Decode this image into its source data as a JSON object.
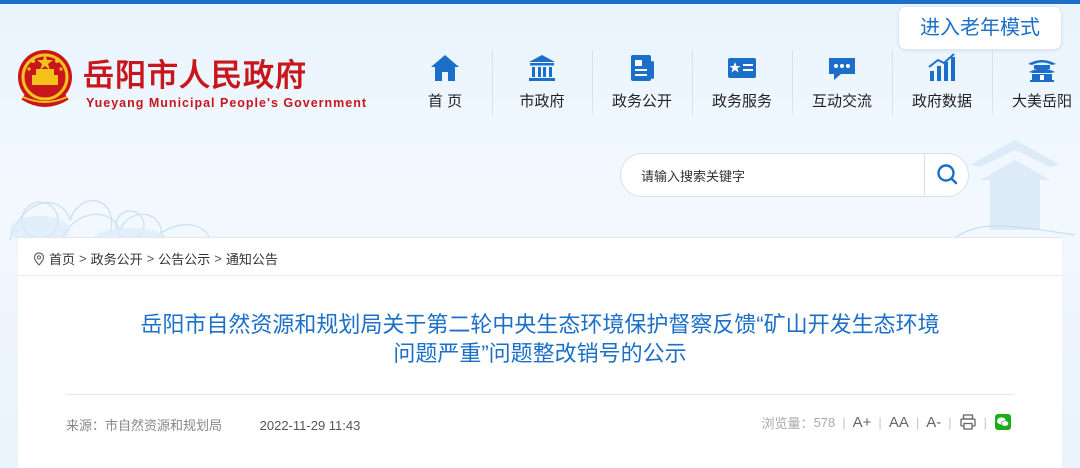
{
  "header": {
    "elder_mode": "进入老年模式",
    "site_title": "岳阳市人民政府",
    "site_subtitle": "Yueyang Municipal People's Government"
  },
  "nav": [
    {
      "label": "首 页",
      "icon": "home-icon"
    },
    {
      "label": "市政府",
      "icon": "government-building-icon"
    },
    {
      "label": "政务公开",
      "icon": "document-icon"
    },
    {
      "label": "政务服务",
      "icon": "service-card-icon"
    },
    {
      "label": "互动交流",
      "icon": "chat-icon"
    },
    {
      "label": "政府数据",
      "icon": "bar-chart-icon"
    },
    {
      "label": "大美岳阳",
      "icon": "pagoda-icon"
    }
  ],
  "search": {
    "placeholder": "请输入搜索关键字"
  },
  "breadcrumb": [
    "首页",
    "政务公开",
    "公告公示",
    "通知公告"
  ],
  "breadcrumb_sep": ">",
  "article": {
    "title_line1": "岳阳市自然资源和规划局关于第二轮中央生态环境保护督察反馈“矿山开发生态环境",
    "title_line2": "问题严重”问题整改销号的公示",
    "source": "来源：市自然资源和规划局",
    "date": "2022-11-29 11:43",
    "views_label": "浏览量：",
    "views": "578"
  },
  "tools": {
    "font_larger": "A+",
    "font_reset": "AA",
    "font_smaller": "A-"
  },
  "colors": {
    "brand_blue": "#1b6fc8",
    "brand_red": "#c8161d",
    "wechat_green": "#1aad19"
  }
}
